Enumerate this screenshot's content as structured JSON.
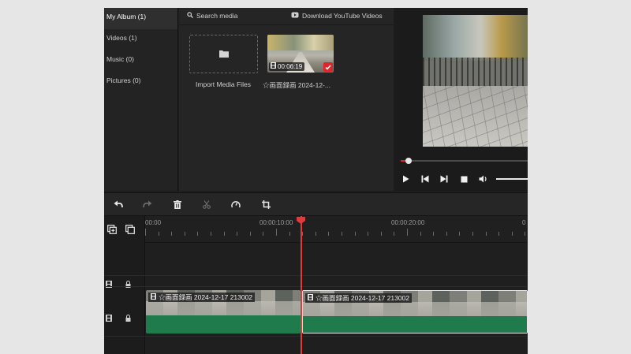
{
  "sidebar": {
    "items": [
      {
        "label": "My Album (1)",
        "active": true
      },
      {
        "label": "Videos (1)"
      },
      {
        "label": "Music (0)"
      },
      {
        "label": "Pictures (0)"
      }
    ]
  },
  "media": {
    "search_label": "Search media",
    "youtube_label": "Download YouTube Videos",
    "import_label": "Import Media Files",
    "items": [
      {
        "duration": "00:06:19",
        "name": "☆画面録画 2024-12-...",
        "selected": true
      }
    ]
  },
  "preview": {
    "seek_progress": 0.06,
    "volume": 1.0
  },
  "timeline": {
    "ruler_labels": [
      "00:00",
      "00:00:10:00",
      "00:00:20:00",
      "0"
    ],
    "clips": [
      {
        "label": "☆画面録画 2024-12-17 213002"
      },
      {
        "label": "☆画面録画 2024-12-17 213002"
      }
    ]
  },
  "colors": {
    "accent": "#e0252a",
    "audio_track": "#1f7a4c",
    "background": "#1e1e1e"
  }
}
